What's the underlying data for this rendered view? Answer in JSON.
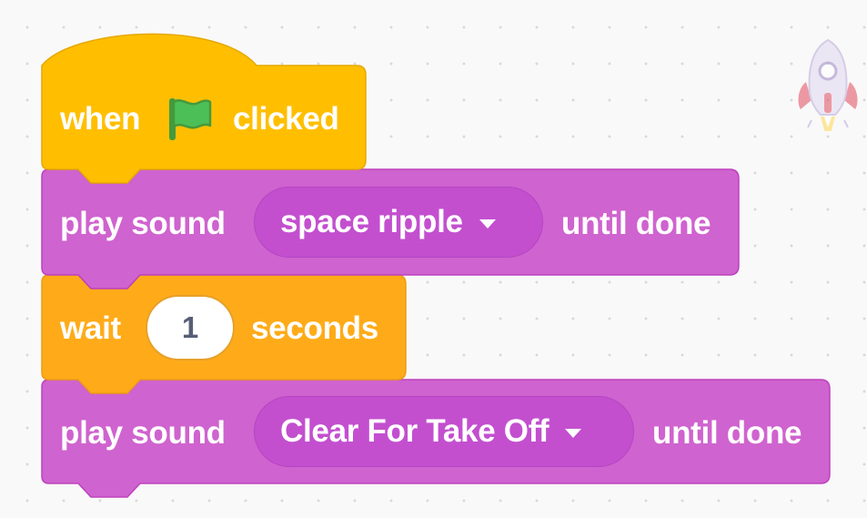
{
  "colors": {
    "events": "#ffbf00",
    "events_dark": "#e6a800",
    "sound": "#cf63cf",
    "sound_dark": "#bd42bd",
    "control": "#ffab19",
    "control_dark": "#ec9c13",
    "flag_green": "#4cbf56"
  },
  "script": {
    "hat_block": {
      "word_when": "when",
      "icon": "green-flag-icon",
      "word_clicked": "clicked"
    },
    "sound_block_1": {
      "word_play_sound": "play sound",
      "sound_name": "space ripple",
      "word_until_done": "until done"
    },
    "wait_block": {
      "word_wait": "wait",
      "value": "1",
      "word_seconds": "seconds"
    },
    "sound_block_2": {
      "word_play_sound": "play sound",
      "sound_name": "Clear For Take Off",
      "word_until_done": "until done"
    }
  },
  "sprite": {
    "icon": "rocketship-sprite-icon"
  }
}
